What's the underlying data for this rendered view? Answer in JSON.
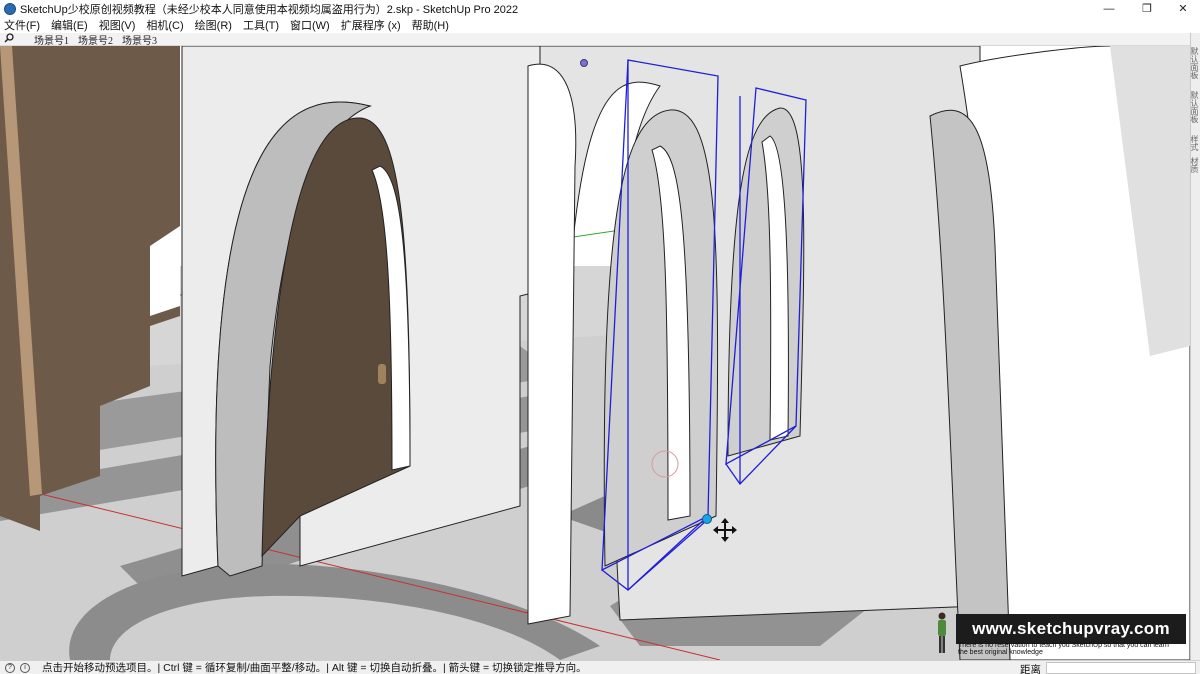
{
  "window": {
    "title": "SketchUp少校原创视频教程（未经少校本人同意使用本视频均属盗用行为）2.skp - SketchUp Pro 2022",
    "minimize_glyph": "—",
    "restore_glyph": "❐",
    "close_glyph": "✕"
  },
  "menu": {
    "items": [
      "文件(F)",
      "编辑(E)",
      "视图(V)",
      "相机(C)",
      "绘图(R)",
      "工具(T)",
      "窗口(W)",
      "扩展程序 (x)",
      "帮助(H)"
    ]
  },
  "scenes": {
    "search_icon": "search-icon",
    "tabs": [
      "场景号1",
      "场景号2",
      "场景号3"
    ]
  },
  "tray": {
    "tabs": [
      "默认面板",
      "默认面板",
      "样式",
      "材质"
    ]
  },
  "watermark": {
    "site": "www.sketchupvray.com",
    "line1": "There is no reservation to teach you SketchUp so that you can learn",
    "line2": "the best original knowledge"
  },
  "status": {
    "help_icon": "info-icon",
    "geo_icon": "geolocation-icon",
    "text": "点击开始移动预选项目。| Ctrl 键 = 循环复制/曲面平整/移动。| Alt 键 = 切换自动折叠。| 箭头键 = 切换锁定推导方向。",
    "measure_label": "距离",
    "measure_value": ""
  },
  "colors": {
    "selection": "#1f1fd8",
    "axis_red": "#c8302b",
    "axis_green": "#2ea82e",
    "wall_face": "#ffffff",
    "wall_shade": "#bdbdbd",
    "ground": "#d0d0d0",
    "shadow": "#8e8e8e",
    "wood": "#6e5a48"
  }
}
